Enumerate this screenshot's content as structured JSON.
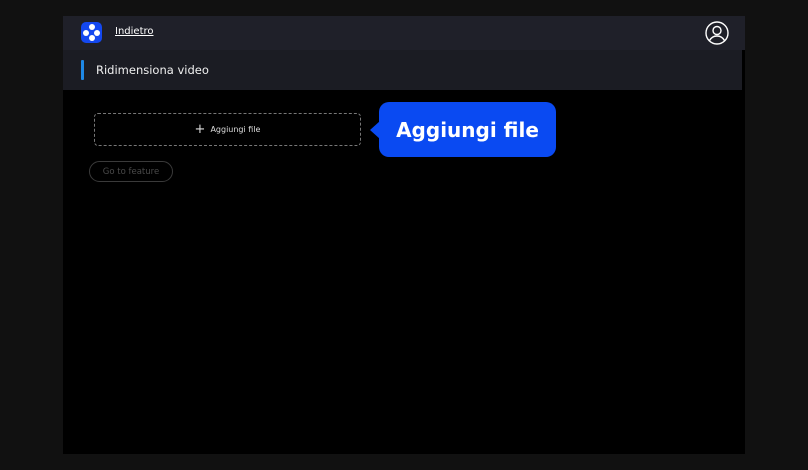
{
  "header": {
    "back_label": "Indietro",
    "logo_icon": "app-logo-icon",
    "user_icon": "user-account-icon"
  },
  "subheader": {
    "title": "Ridimensiona video"
  },
  "main": {
    "add_file_label": "Aggiungi file",
    "add_icon": "plus-icon",
    "go_to_feature_label": "Go to feature"
  },
  "tooltip": {
    "text": "Aggiungi file"
  },
  "colors": {
    "accent": "#0a4af2",
    "bar": "#1e88e5"
  }
}
